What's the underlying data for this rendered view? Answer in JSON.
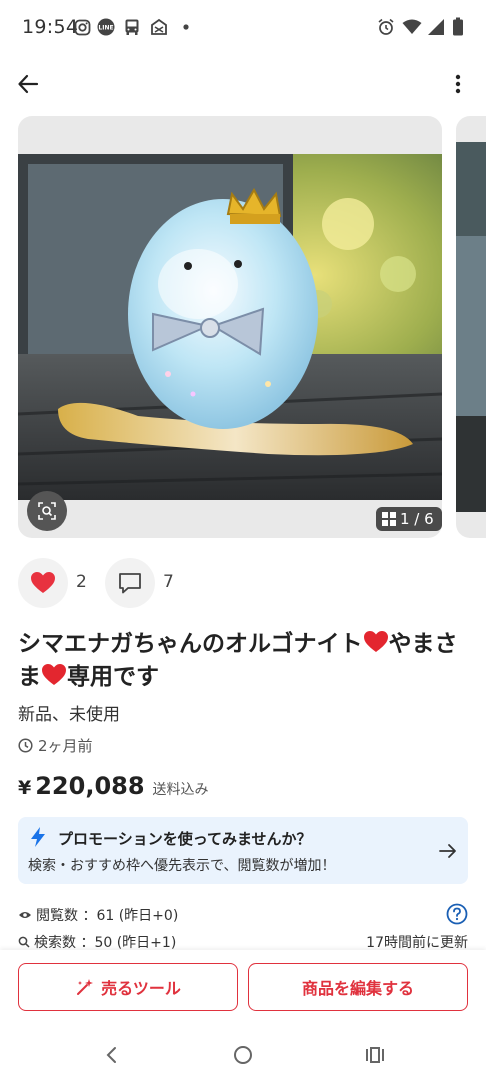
{
  "status_bar": {
    "time": "19:54"
  },
  "icons": {
    "back": "back-arrow-icon",
    "more": "more-vert-icon",
    "zoom": "image-search-icon",
    "grid": "grid-icon",
    "like": "heart-icon",
    "comment": "comment-icon",
    "clock": "clock-icon",
    "bolt": "lightning-icon",
    "arrow": "arrow-right-icon",
    "views": "eye-icon",
    "search": "search-icon",
    "help": "help-icon",
    "sell_tool": "sparkle-wand-icon"
  },
  "carousel": {
    "counter": "1 / 6"
  },
  "reactions": {
    "likes": "2",
    "comments": "7"
  },
  "item": {
    "title_part1": "シマエナガちゃんのオルゴナイト",
    "title_part2": "やまさま",
    "title_part3": "専用です",
    "condition": "新品、未使用",
    "posted": "2ヶ月前",
    "price_currency": "¥",
    "price": "220,088",
    "price_note": "送料込み"
  },
  "promo": {
    "title": "プロモーションを使ってみませんか？",
    "subtitle": "検索・おすすめ枠へ優先表示で、閲覧数が増加！"
  },
  "stats": {
    "views": "閲覧数 ：61 (昨日+0)",
    "searches": "検索数 ：50 (昨日+1)",
    "updated": "17時間前に更新"
  },
  "actions": {
    "sell_tool": "売るツール",
    "edit_item": "商品を編集する"
  },
  "colors": {
    "accent_red": "#e0323e",
    "heart_red": "#e8323f",
    "promo_bg": "#eaf3fd",
    "bolt_blue": "#1a73e8"
  }
}
